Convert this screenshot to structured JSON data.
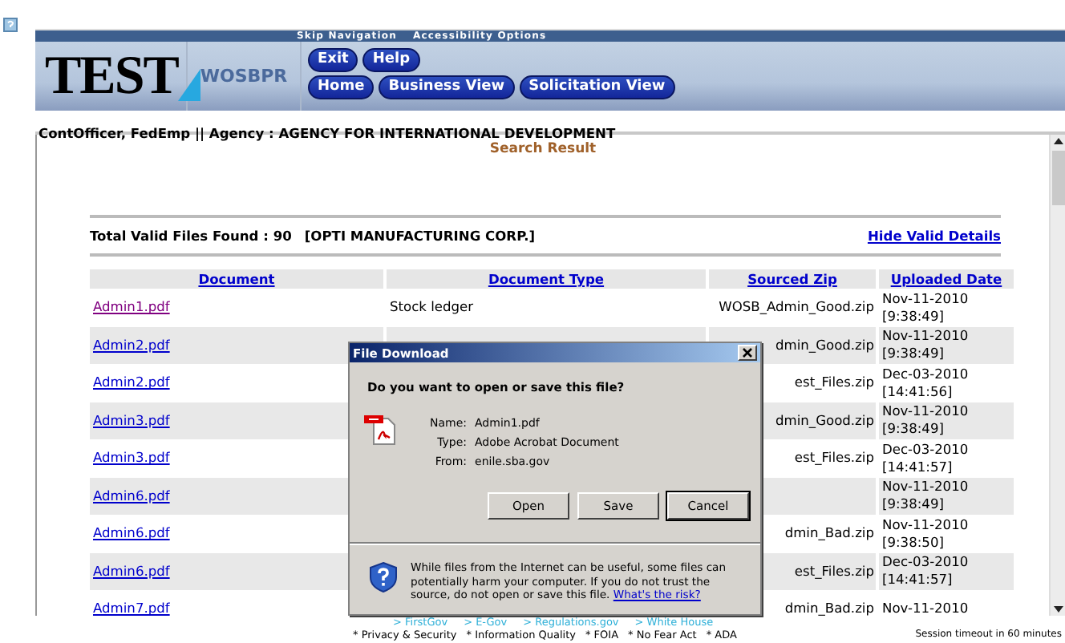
{
  "header": {
    "skip_links": [
      "Skip Navigation",
      "Accessibility Options"
    ],
    "logo": "TEST",
    "app_name": "WOSBPR",
    "top_buttons": [
      "Exit",
      "Help"
    ],
    "nav_buttons": [
      "Home",
      "Business View",
      "Solicitation View"
    ]
  },
  "breadcrumb": "ContOfficer, FedEmp || Agency : AGENCY FOR INTERNATIONAL DEVELOPMENT",
  "results": {
    "title": "Search Result",
    "summary": "Total Valid Files Found : 90",
    "company": "[OPTI MANUFACTURING CORP.]",
    "toggle_link": "Hide Valid Details",
    "columns": [
      "Document",
      "Document Type",
      "Sourced Zip",
      "Uploaded Date"
    ],
    "rows": [
      {
        "document": "Admin1.pdf",
        "visited": true,
        "document_type": "Stock ledger",
        "sourced_zip": "WOSB_Admin_Good.zip",
        "date": "Nov-11-2010",
        "time": "[9:38:49]"
      },
      {
        "document": "Admin2.pdf",
        "visited": false,
        "sourced_zip": "dmin_Good.zip",
        "date": "Nov-11-2010",
        "time": "[9:38:49]"
      },
      {
        "document": "Admin2.pdf",
        "visited": false,
        "sourced_zip": "est_Files.zip",
        "date": "Dec-03-2010",
        "time": "[14:41:56]"
      },
      {
        "document": "Admin3.pdf",
        "visited": false,
        "sourced_zip": "dmin_Good.zip",
        "date": "Nov-11-2010",
        "time": "[9:38:49]"
      },
      {
        "document": "Admin3.pdf",
        "visited": false,
        "sourced_zip": "est_Files.zip",
        "date": "Dec-03-2010",
        "time": "[14:41:57]"
      },
      {
        "document": "Admin6.pdf",
        "visited": false,
        "date": "Nov-11-2010",
        "time": "[9:38:49]"
      },
      {
        "document": "Admin6.pdf",
        "visited": false,
        "sourced_zip": "dmin_Bad.zip",
        "date": "Nov-11-2010",
        "time": "[9:38:50]"
      },
      {
        "document": "Admin6.pdf",
        "visited": false,
        "sourced_zip": "est_Files.zip",
        "date": "Dec-03-2010",
        "time": "[14:41:57]"
      },
      {
        "document": "Admin7.pdf",
        "visited": false,
        "sourced_zip": "dmin_Bad.zip",
        "date": "Nov-11-2010"
      }
    ]
  },
  "dialog": {
    "title": "File Download",
    "question": "Do you want to open or save this file?",
    "fields": [
      {
        "label": "Name:",
        "value": "Admin1.pdf"
      },
      {
        "label": "Type:",
        "value": "Adobe Acrobat Document"
      },
      {
        "label": "From:",
        "value": "enile.sba.gov"
      }
    ],
    "buttons": [
      {
        "label": "Open",
        "default": false
      },
      {
        "label": "Save",
        "default": false
      },
      {
        "label": "Cancel",
        "default": true
      }
    ],
    "warning": "While files from the Internet can be useful, some files can potentially harm your computer. If you do not trust the source, do not open or save this file.",
    "warning_link": "What's the risk?"
  },
  "footer": {
    "links": [
      "> FirstGov",
      "> E-Gov",
      "> Regulations.gov",
      "> White House"
    ],
    "policy_links": [
      "* Privacy & Security",
      "* Information Quality",
      "* FOIA",
      "* No Fear Act",
      "* ADA"
    ],
    "session_note": "Session timeout in 60 minutes"
  }
}
